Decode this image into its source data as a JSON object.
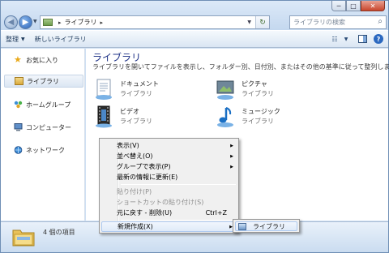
{
  "window": {
    "controls": {
      "minimize": "─",
      "maximize": "□",
      "close": "✕"
    }
  },
  "address": {
    "path_items": [
      "ライブラリ"
    ],
    "separator": "▸"
  },
  "search": {
    "placeholder": "ライブラリの検索"
  },
  "toolbar": {
    "organize": "整理",
    "new_library": "新しいライブラリ"
  },
  "nav": {
    "items": [
      {
        "label": "お気に入り",
        "icon": "star-icon"
      },
      {
        "label": "ライブラリ",
        "icon": "library-icon",
        "selected": true
      },
      {
        "label": "ホームグループ",
        "icon": "homegroup-icon"
      },
      {
        "label": "コンピューター",
        "icon": "computer-icon"
      },
      {
        "label": "ネットワーク",
        "icon": "network-icon"
      }
    ]
  },
  "content": {
    "title": "ライブラリ",
    "subtitle": "ライブラリを開いてファイルを表示し、フォルダー別、日付別、またはその他の基準に従って整列します。",
    "libraries": [
      {
        "name": "ドキュメント",
        "kind": "ライブラリ",
        "icon": "documents-icon"
      },
      {
        "name": "ピクチャ",
        "kind": "ライブラリ",
        "icon": "pictures-icon"
      },
      {
        "name": "ビデオ",
        "kind": "ライブラリ",
        "icon": "videos-icon"
      },
      {
        "name": "ミュージック",
        "kind": "ライブラリ",
        "icon": "music-icon"
      }
    ]
  },
  "status": {
    "text": "4 個の項目"
  },
  "context_menu": {
    "items": [
      {
        "label": "表示(V)",
        "submenu": true
      },
      {
        "label": "並べ替え(O)",
        "submenu": true
      },
      {
        "label": "グループで表示(P)",
        "submenu": true
      },
      {
        "label": "最新の情報に更新(E)"
      },
      {
        "label": "貼り付け(P)",
        "disabled": true
      },
      {
        "label": "ショートカットの貼り付け(S)",
        "disabled": true
      },
      {
        "label": "元に戻す - 削除(U)",
        "shortcut": "Ctrl+Z"
      },
      {
        "label": "新規作成(X)",
        "submenu": true,
        "hover": true
      }
    ],
    "submenu_arrow": "▶"
  },
  "new_submenu": {
    "items": [
      {
        "label": "ライブラリ",
        "icon": "library-icon"
      }
    ]
  }
}
